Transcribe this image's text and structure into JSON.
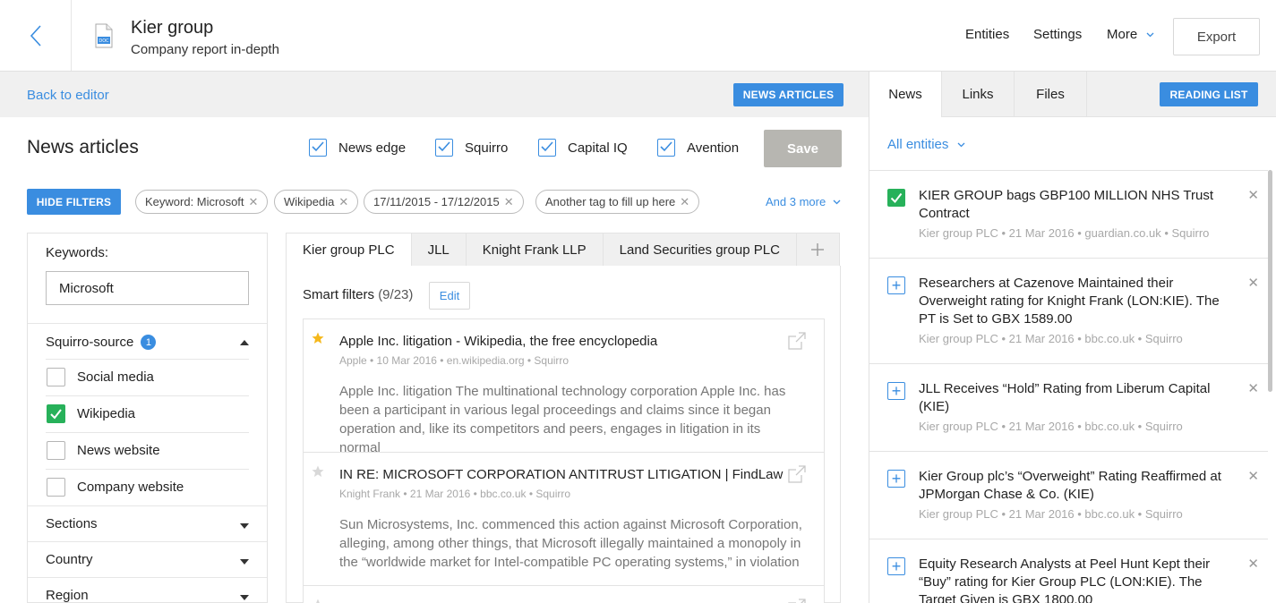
{
  "header": {
    "title": "Kier group",
    "subtitle": "Company report in-depth",
    "nav": {
      "entities": "Entities",
      "settings": "Settings",
      "more": "More"
    },
    "export_label": "Export"
  },
  "editor_bar": {
    "back_label": "Back to editor",
    "news_articles_label": "NEWS ARTICLES"
  },
  "news": {
    "heading": "News articles",
    "sources": [
      {
        "label": "News edge",
        "checked": true
      },
      {
        "label": "Squirro",
        "checked": true
      },
      {
        "label": "Capital IQ",
        "checked": true
      },
      {
        "label": "Avention",
        "checked": true
      }
    ],
    "save_label": "Save",
    "hide_filters_label": "HIDE FILTERS",
    "tags": [
      "Keyword: Microsoft",
      "Wikipedia",
      "17/11/2015 - 17/12/2015",
      "Another tag to fill up here"
    ],
    "and_more_label": "And 3 more"
  },
  "filters": {
    "keywords_label": "Keywords:",
    "keywords_value": "Microsoft",
    "source_group": {
      "label": "Squirro-source",
      "count": "1"
    },
    "options": [
      {
        "label": "Social media",
        "checked": false
      },
      {
        "label": "Wikipedia",
        "checked": true
      },
      {
        "label": "News website",
        "checked": false
      },
      {
        "label": "Company website",
        "checked": false
      }
    ],
    "sections": [
      "Sections",
      "Country",
      "Region"
    ]
  },
  "entity_tabs": [
    "Kier group PLC",
    "JLL",
    "Knight Frank LLP",
    "Land Securities group PLC"
  ],
  "smart_filters": {
    "label": "Smart filters",
    "count": "(9/23)",
    "edit_label": "Edit"
  },
  "articles": [
    {
      "title": "Apple Inc. litigation - Wikipedia, the free encyclopedia",
      "meta": "Apple  •  10 Mar 2016  •  en.wikipedia.org  •  Squirro",
      "snippet": "Apple Inc. litigation The multinational technology corporation Apple Inc. has been a participant in various legal proceedings and claims since it began operation and, like its competitors and peers, engages in litigation in its normal",
      "starred": true
    },
    {
      "title": "IN RE: MICROSOFT CORPORATION ANTITRUST LITIGATION | FindLaw",
      "meta": "Knight Frank  •  21 Mar 2016  •  bbc.co.uk  •  Squirro",
      "snippet": "Sun Microsystems, Inc. commenced this action against Microsoft Corporation, alleging, among other things, that Microsoft illegally maintained a monopoly in the “worldwide market for Intel-compatible PC operating systems,” in violation",
      "starred": false
    }
  ],
  "right_panel": {
    "tabs": [
      "News",
      "Links",
      "Files"
    ],
    "reading_list_label": "READING LIST",
    "all_entities_label": "All entities",
    "items": [
      {
        "title": "KIER GROUP bags GBP100 MILLION NHS Trust Contract",
        "meta": "Kier group PLC  •  21 Mar 2016  •  guardian.co.uk  •  Squirro",
        "added": true
      },
      {
        "title": "Researchers at Cazenove Maintained their Overweight rating for Knight Frank (LON:KIE). The PT is Set to GBX 1589.00",
        "meta": "Kier group PLC  •  21 Mar 2016  •  bbc.co.uk  •  Squirro",
        "added": false
      },
      {
        "title": "JLL Receives “Hold” Rating from Liberum Capital (KIE)",
        "meta": "Kier group PLC  •  21 Mar 2016  •  bbc.co.uk  •  Squirro",
        "added": false
      },
      {
        "title": "Kier Group plc’s “Overweight” Rating Reaffirmed at JPMorgan Chase & Co. (KIE)",
        "meta": "Kier group PLC  •  21 Mar 2016  •  bbc.co.uk  •  Squirro",
        "added": false
      },
      {
        "title": "Equity Research Analysts at Peel Hunt Kept their “Buy” rating for Kier Group PLC (LON:KIE). The Target Given is GBX 1800.00",
        "meta": "",
        "added": false
      }
    ]
  },
  "colors": {
    "accent": "#3a8de0",
    "check_green": "#27b15a",
    "save_disabled": "#b7b6b1"
  }
}
